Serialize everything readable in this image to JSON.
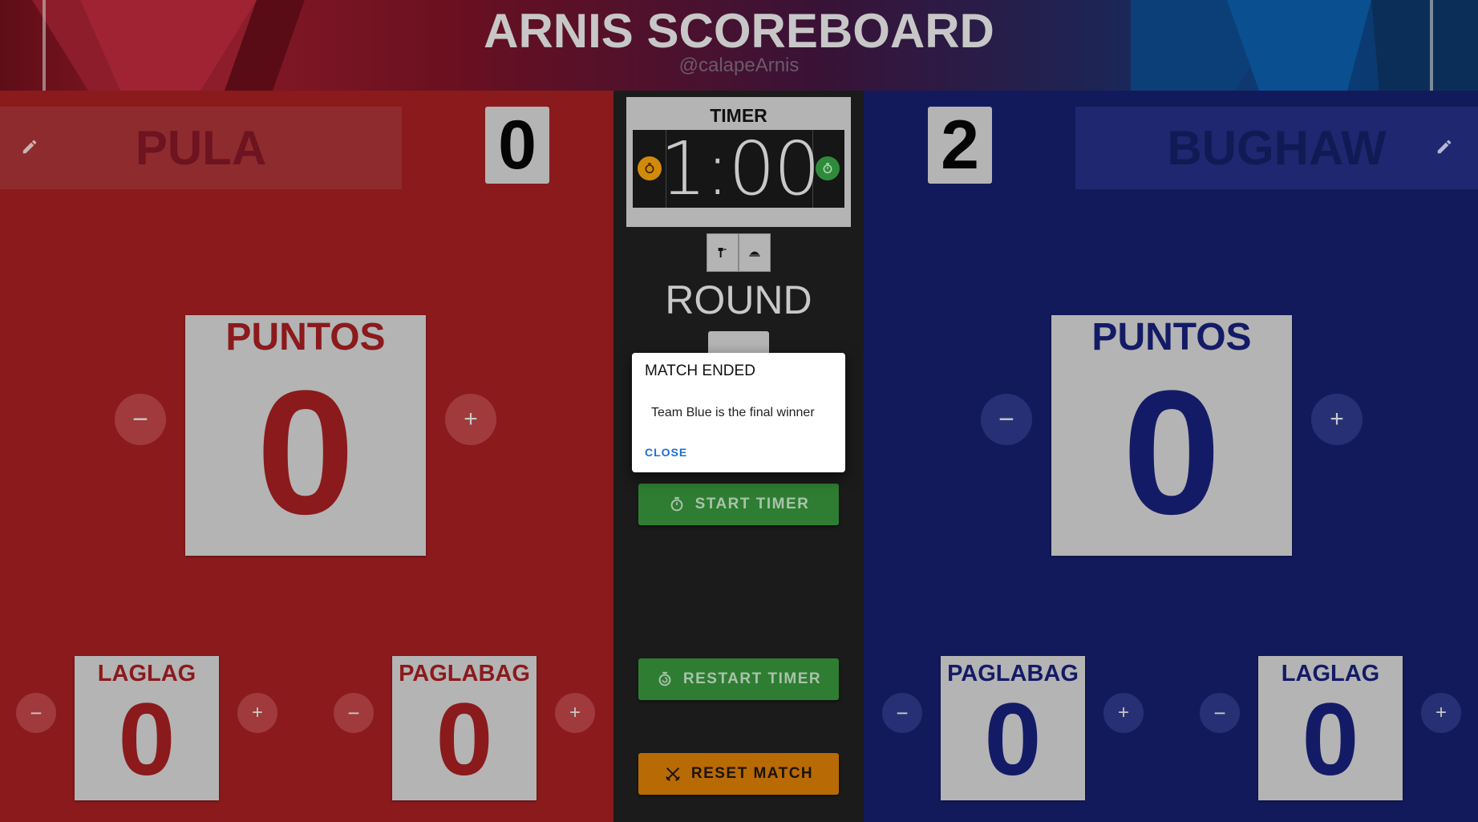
{
  "header": {
    "title": "ARNIS SCOREBOARD",
    "handle": "@calapeArnis"
  },
  "red": {
    "team_name": "PULA",
    "round_wins": "0",
    "puntos": {
      "label": "PUNTOS",
      "value": "0"
    },
    "laglag": {
      "label": "LAGLAG",
      "value": "0"
    },
    "paglabag": {
      "label": "PAGLABAG",
      "value": "0"
    },
    "color_bg": "#8b1a1c",
    "color_text": "#8b1a1c"
  },
  "blue": {
    "team_name": "BUGHAW",
    "round_wins": "2",
    "puntos": {
      "label": "PUNTOS",
      "value": "0"
    },
    "paglabag": {
      "label": "PAGLABAG",
      "value": "0"
    },
    "laglag": {
      "label": "LAGLAG",
      "value": "0"
    },
    "color_bg": "#131a5c",
    "color_text": "#141b66"
  },
  "timer": {
    "label": "TIMER",
    "display": "1:00"
  },
  "round": {
    "label": "ROUND"
  },
  "buttons": {
    "minus": "−",
    "plus": "+",
    "start_timer": "START TIMER",
    "restart_timer": "RESTART TIMER",
    "reset_match": "RESET MATCH"
  },
  "dialog": {
    "title": "MATCH ENDED",
    "message": "Team Blue is the final winner",
    "close": "CLOSE"
  },
  "icons": {
    "edit": "pencil-icon",
    "pause": "timer-pause-icon",
    "start": "stopwatch-icon",
    "gavel": "gavel-icon",
    "bell": "bell-icon",
    "restart": "timer-restart-icon",
    "swords": "crossed-swords-icon"
  }
}
